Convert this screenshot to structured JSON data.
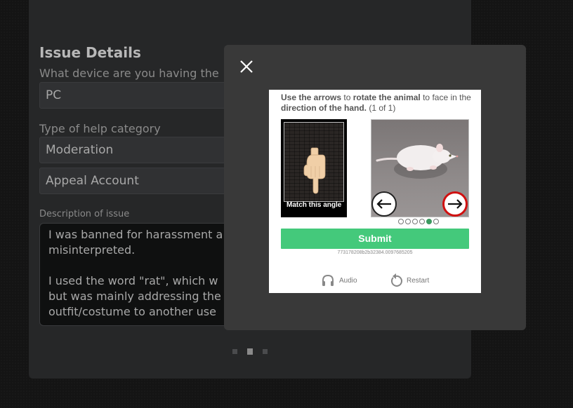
{
  "form": {
    "section_title": "Issue Details",
    "device_label": "What device are you having the",
    "device_value": "PC",
    "category_label": "Type of help category",
    "category_value": "Moderation",
    "subcategory_value": "Appeal Account",
    "description_label": "Description of issue",
    "description_text": "I was banned for harassment a\nmisinterpreted.\n\nI used the word \"rat\", which w\nbut was mainly addressing the\noutfit/costume to another use",
    "pager": {
      "count": 3,
      "active": 2
    }
  },
  "modal": {
    "close_icon": "close-icon",
    "captcha": {
      "instr_1": "Use the arrows",
      "instr_2": " to ",
      "instr_3": "rotate the animal",
      "instr_4": " to face in the ",
      "instr_5": "direction of the hand.",
      "instr_6": " (1 of 1)",
      "match_label": "Match this angle",
      "submit_label": "Submit",
      "session_id": "773178208b2b32384.0097685205",
      "audio_label": "Audio",
      "restart_label": "Restart",
      "progress": {
        "count": 6,
        "active": 5
      },
      "accent_color": "#44c97b"
    }
  }
}
